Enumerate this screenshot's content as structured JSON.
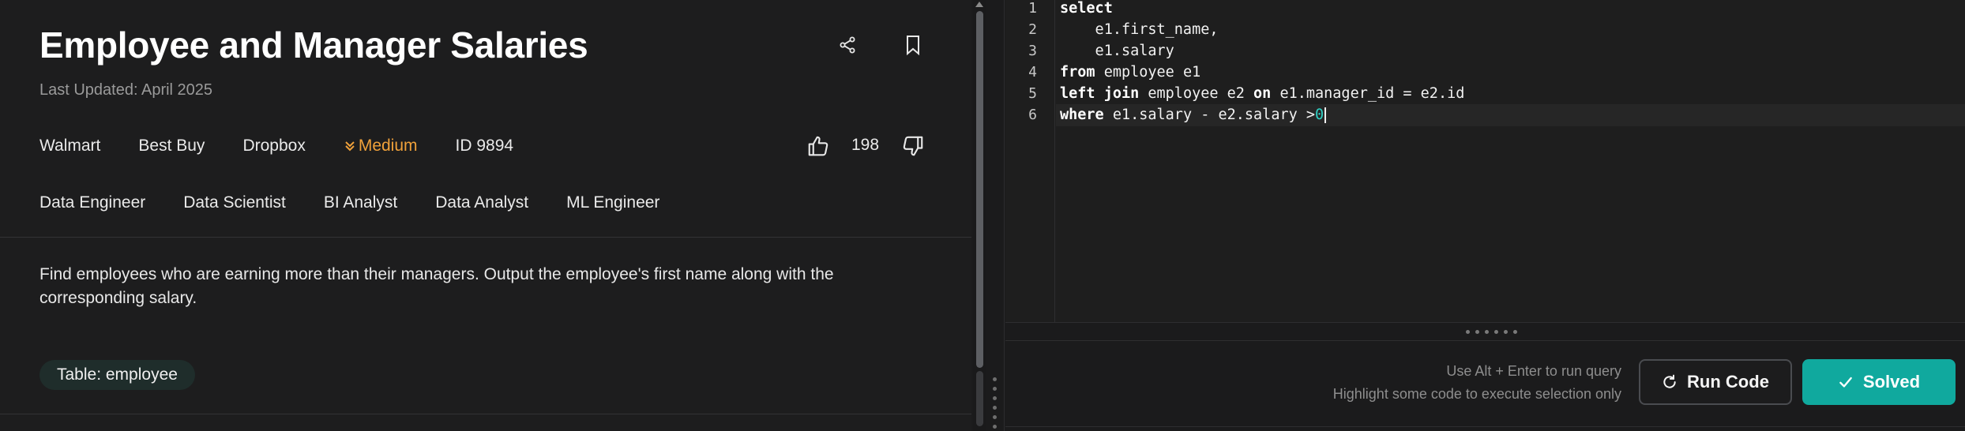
{
  "question": {
    "title": "Employee and Manager Salaries",
    "last_updated": "Last Updated: April 2025",
    "companies": [
      "Walmart",
      "Best Buy",
      "Dropbox"
    ],
    "difficulty": "Medium",
    "id_label": "ID 9894",
    "votes": "198",
    "roles": [
      "Data Engineer",
      "Data Scientist",
      "BI Analyst",
      "Data Analyst",
      "ML Engineer"
    ],
    "description": "Find employees who are earning more than their managers. Output the employee's first name along with the corresponding salary.",
    "table_badge": "Table: employee",
    "icons": {
      "share": "share-icon",
      "bookmark": "bookmark-icon",
      "like": "thumbs-up-icon",
      "dislike": "thumbs-down-icon",
      "difficulty": "chevrons-down-icon"
    }
  },
  "editor": {
    "line_numbers": [
      "1",
      "2",
      "3",
      "4",
      "5",
      "6"
    ],
    "lines": [
      {
        "kw": "select",
        "rest": ""
      },
      {
        "kw": "",
        "rest": "    e1.first_name,"
      },
      {
        "kw": "",
        "rest": "    e1.salary"
      },
      {
        "kw": "from",
        "rest": " employee e1"
      },
      {
        "kw": "left join",
        "rest": " employee e2 ",
        "kw2": "on",
        "rest2": " e1.manager_id = e2.id"
      },
      {
        "kw": "where",
        "rest": " e1.salary - e2.salary >",
        "num": "0"
      }
    ]
  },
  "toolbar": {
    "hint_line1": "Use Alt + Enter to run query",
    "hint_line2": "Highlight some code to execute selection only",
    "run_label": "Run Code",
    "solved_label": "Solved"
  },
  "colors": {
    "accent": "#10a99e",
    "medium": "#f0a13a",
    "number": "#2fd0c4"
  }
}
